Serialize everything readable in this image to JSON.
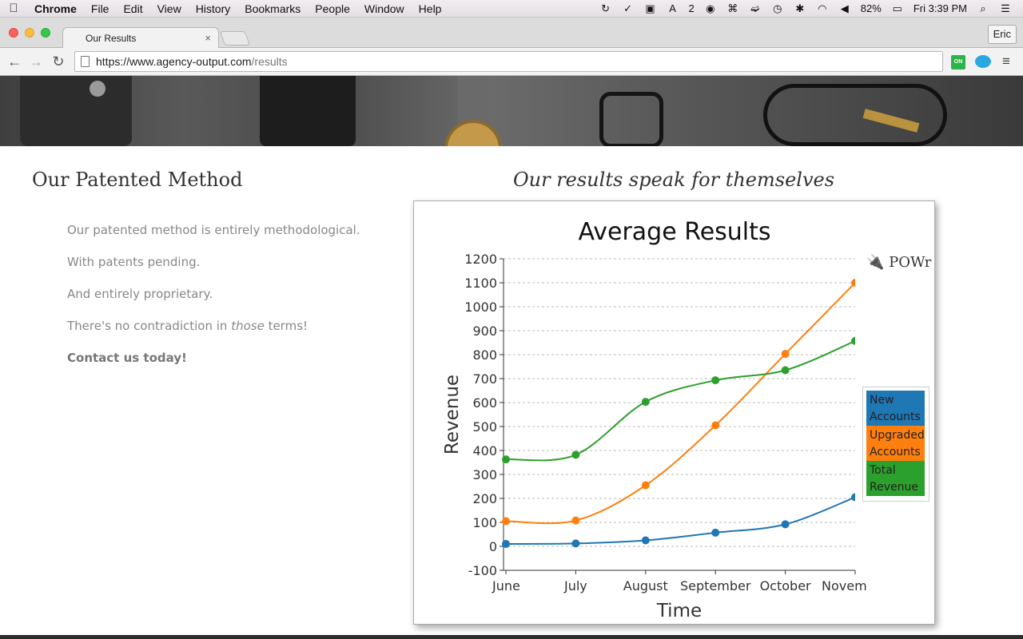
{
  "menubar": {
    "app_name": "Chrome",
    "items": [
      "File",
      "Edit",
      "View",
      "History",
      "Bookmarks",
      "People",
      "Window",
      "Help"
    ],
    "status": {
      "adobe_count": "2",
      "battery": "82%",
      "clock": "Fri 3:39 PM"
    }
  },
  "browser": {
    "tab_title": "Our Results",
    "tab_close": "×",
    "profile_name": "Eric",
    "url_host": "https://www.agency-output.com",
    "url_path": "/results",
    "ext_label": "ON"
  },
  "page": {
    "left_heading": "Our Patented Method",
    "paragraphs": [
      "Our patented method is entirely methodological.",
      "With patents pending.",
      "And entirely proprietary."
    ],
    "para4_before": "There's no contradiction in ",
    "para4_em": "those",
    "para4_after": " terms!",
    "contact": "Contact us today!",
    "right_heading": "Our results speak for themselves"
  },
  "widget": {
    "brand": "POWr"
  },
  "chart_data": {
    "type": "line",
    "title": "Average Results",
    "xlabel": "Time",
    "ylabel": "Revenue",
    "categories": [
      "June",
      "July",
      "August",
      "September",
      "October",
      "Novem"
    ],
    "ylim": [
      -100,
      1200
    ],
    "yticks": [
      -100,
      0,
      100,
      200,
      300,
      400,
      500,
      600,
      700,
      800,
      900,
      1000,
      1100,
      1200
    ],
    "grid": true,
    "legend_position": "right",
    "series": [
      {
        "name": "New Accounts",
        "color": "#1f77b4",
        "values": [
          10,
          12,
          25,
          57,
          92,
          205
        ]
      },
      {
        "name": "Upgraded Accounts",
        "color": "#ff7f0e",
        "values": [
          105,
          108,
          255,
          505,
          803,
          1100
        ]
      },
      {
        "name": "Total Revenue",
        "color": "#2ca02c",
        "values": [
          363,
          382,
          603,
          693,
          735,
          857
        ]
      }
    ]
  }
}
